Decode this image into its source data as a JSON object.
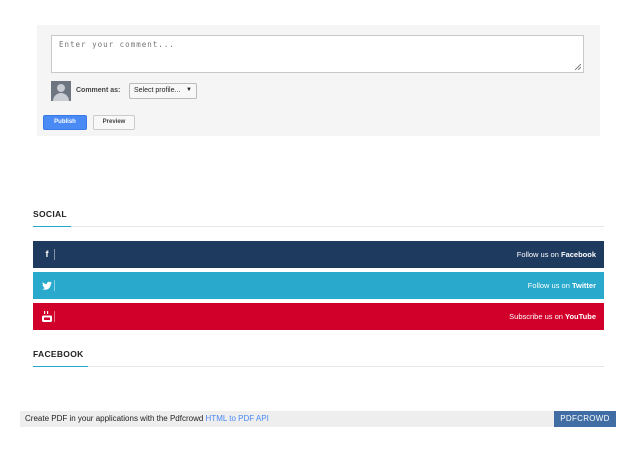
{
  "comment_form": {
    "placeholder": "Enter your comment...",
    "comment_as_label": "Comment as:",
    "profile_select_value": "Select profile...",
    "publish_label": "Publish",
    "preview_label": "Preview"
  },
  "social": {
    "title": "SOCIAL",
    "items": [
      {
        "prefix": "Follow us on ",
        "network": "Facebook",
        "icon": "facebook-icon",
        "color": "#1e3a5f"
      },
      {
        "prefix": "Follow us on ",
        "network": "Twitter",
        "icon": "twitter-icon",
        "color": "#29a9cb"
      },
      {
        "prefix": "Subscribe us on ",
        "network": "YouTube",
        "icon": "youtube-icon",
        "color": "#d0002b"
      }
    ]
  },
  "facebook_section": {
    "title": "FACEBOOK"
  },
  "footer": {
    "text": "Create PDF in your applications with the Pdfcrowd ",
    "link": "HTML to PDF API",
    "badge": "PDFCROWD"
  },
  "colors": {
    "accent": "#26a6c9",
    "publish_button": "#4a8af4",
    "footer_badge": "#3f6da4"
  }
}
